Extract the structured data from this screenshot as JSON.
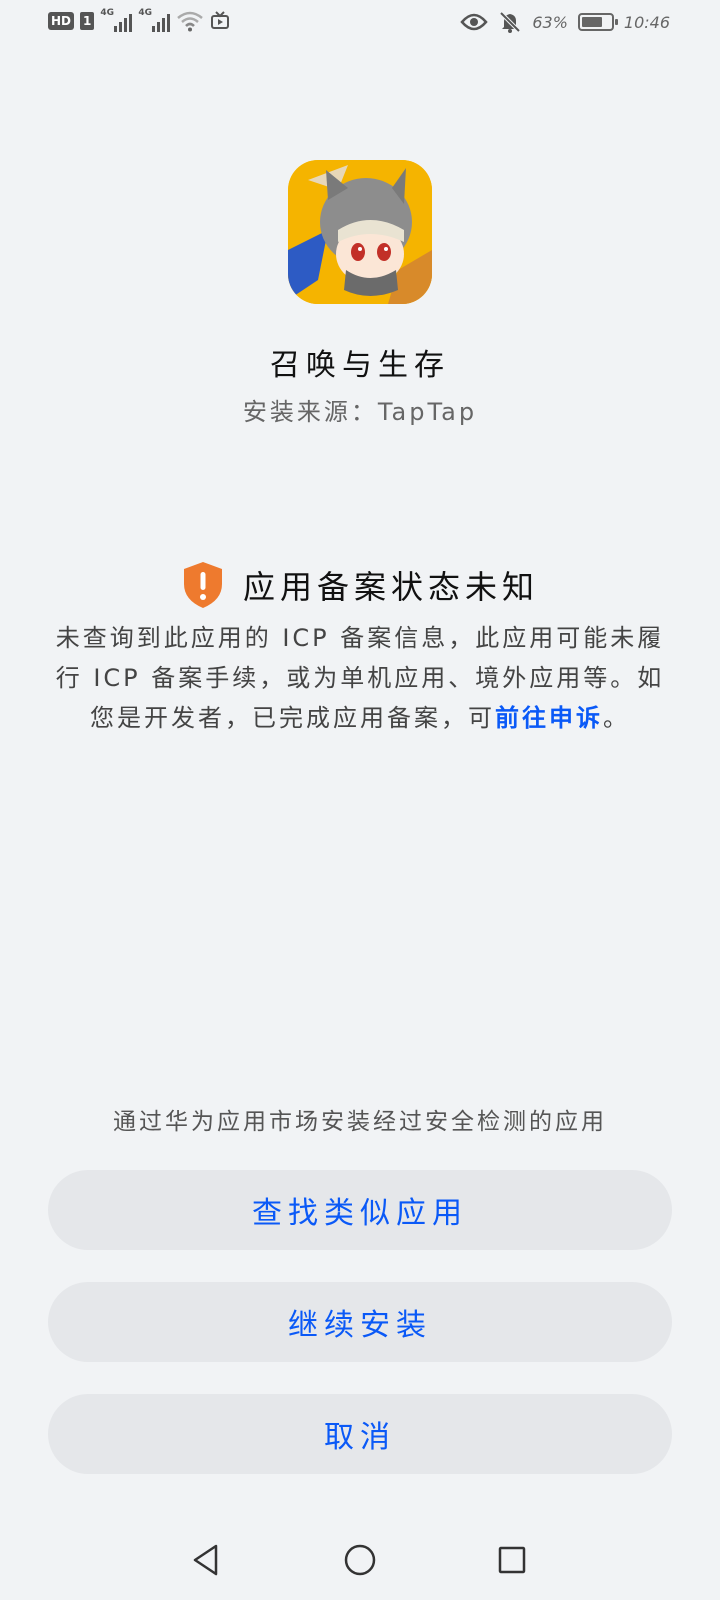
{
  "status_bar": {
    "hd": "HD",
    "sim": "1",
    "net1": "4G",
    "net2": "4G",
    "battery_percent": "63%",
    "battery_level": 0.63,
    "time": "10:46",
    "icons": [
      "hd-icon",
      "sim1-icon",
      "signal-icon",
      "signal-icon",
      "wifi-icon",
      "tv-icon",
      "eye-icon",
      "mute-bell-icon",
      "battery-icon"
    ]
  },
  "app": {
    "name": "召唤与生存",
    "install_source": "安装来源：TapTap",
    "icon": "app-icon"
  },
  "warning": {
    "icon": "shield-warning-icon",
    "icon_color": "#ee7a2e",
    "title": "应用备案状态未知",
    "body_text": "未查询到此应用的 ICP 备案信息，此应用可能未履行 ICP 备案手续，或为单机应用、境外应用等。如您是开发者，已完成应用备案，可",
    "appeal_link": "前往申诉",
    "body_end": "。"
  },
  "hint": "通过华为应用市场安装经过安全检测的应用",
  "buttons": {
    "find_similar": "查找类似应用",
    "continue_install": "继续安装",
    "cancel": "取消"
  },
  "accent_color": "#0a59f7",
  "nav": [
    "back-icon",
    "home-icon",
    "recents-icon"
  ]
}
